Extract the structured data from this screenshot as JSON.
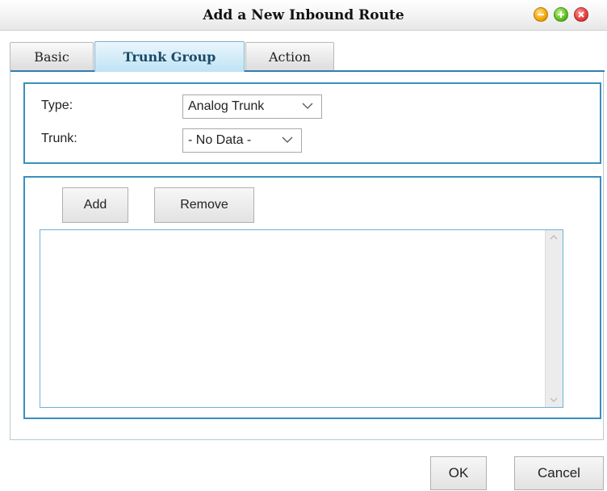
{
  "window": {
    "title": "Add a New Inbound Route",
    "controls": [
      "minimize-icon",
      "maximize-icon",
      "close-icon"
    ]
  },
  "tabs": [
    {
      "label": "Basic",
      "active": false
    },
    {
      "label": "Trunk Group",
      "active": true
    },
    {
      "label": "Action",
      "active": false
    }
  ],
  "form": {
    "type_label": "Type:",
    "type_value": "Analog Trunk",
    "trunk_label": "Trunk:",
    "trunk_value": "- No Data -"
  },
  "list_actions": {
    "add_label": "Add",
    "remove_label": "Remove"
  },
  "list": {
    "items": []
  },
  "footer": {
    "ok_label": "OK",
    "cancel_label": "Cancel"
  },
  "colors": {
    "accent_border": "#3a8fbd",
    "active_tab_bg": "#bfe3f4"
  }
}
